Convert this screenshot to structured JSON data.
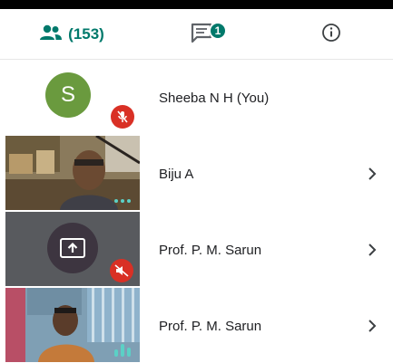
{
  "tabs": {
    "people_count": "(153)",
    "chat_badge": "1"
  },
  "colors": {
    "accent": "#00796b",
    "avatar_bg": "#6a9a3e",
    "mute_red": "#d93025",
    "audio_teal": "#5bd1c6"
  },
  "participants": [
    {
      "name": "Sheeba N H (You)",
      "avatar_letter": "S",
      "muted": true
    },
    {
      "name": "Biju A",
      "speaking_indicator": "dots"
    },
    {
      "name": "Prof. P. M. Sarun",
      "presenting": true,
      "muted": true
    },
    {
      "name": "Prof. P. M. Sarun",
      "speaking_indicator": "bars"
    }
  ]
}
